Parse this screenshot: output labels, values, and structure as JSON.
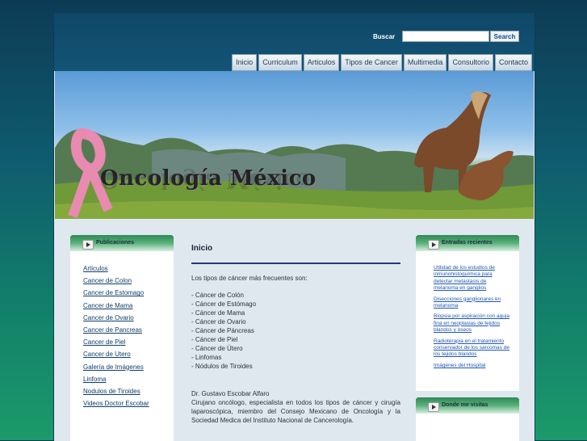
{
  "search": {
    "label": "Buscar",
    "placeholder": "",
    "button_label": "Search"
  },
  "nav": {
    "items": [
      "Inicio",
      "Curriculum",
      "Articulos",
      "Tipos de Cancer",
      "Multimedia",
      "Consultorio",
      "Contacto"
    ]
  },
  "banner": {
    "title": "Oncología México",
    "ribbon_color": "#e98ab1"
  },
  "left_sidebar": {
    "title": "Publicaciones",
    "links": [
      "Articulos",
      "Cancer de Colon",
      "Cancer de Estomago",
      "Cancer de Mama",
      "Cancer de Ovario",
      "Cancer de Pancreas",
      "Cancer de Piel",
      "Cancer de Utero",
      "Galería de Imágenes",
      "Linfoma",
      "Nodulos de Tiroides",
      "Videos Doctor Escobar"
    ]
  },
  "content": {
    "title": "Inicio",
    "intro": "Los tipos de cáncer más frecuentes son:",
    "cancer_list": [
      "- Cáncer de Colón",
      "- Cáncer de Estómago",
      "- Cáncer de Mama",
      "- Cáncer de Ovario",
      "- Cáncer de Páncreas",
      "- Cáncer de Piel",
      "- Cáncer de Útero",
      "- Linfomas",
      "- Nódulos de Tiroides"
    ],
    "doctor_name": "Dr. Gustavo Escobar Alfaro",
    "doctor_bio": "Cirujano oncólogo, especialista en todos los tipos de cáncer y cirugía laparoscópica, miembro del Consejo Mexicano de Oncología y la Sociedad Medica del Instituto Nacional de Cancerología."
  },
  "right_sidebar": {
    "recent_title": "Entradas recientes",
    "recent_links": [
      "Utilidad de los estudios de inmunohistoquímica para detectar metastasis de melanoma en ganglios",
      "Disecciones ganglionares en melanoma",
      "Biopsia por aspiración con aguja fina en neoplasias de tejidos blandos y óseos",
      "Radioterapia en el tratamiento conservador de los sarcomas de los tejidos blandos",
      "Imágenes del Hospital"
    ],
    "visit_title": "Donde me visitas"
  },
  "colors": {
    "nav_text": "#1d3b5a",
    "link": "#1f57b0",
    "sidebar_header": "#2f8a57",
    "page_background": "#dfe8ee"
  }
}
